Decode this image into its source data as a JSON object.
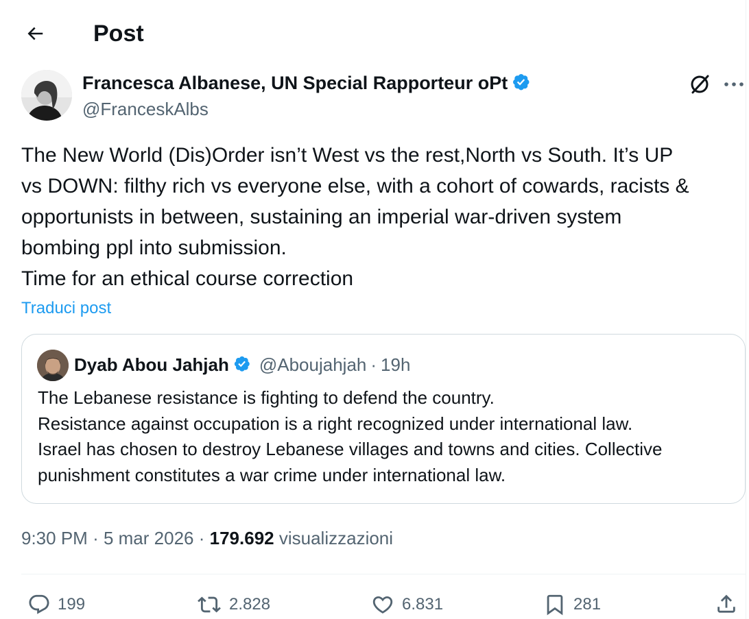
{
  "header": {
    "title": "Post",
    "back_icon": "arrow-left-icon"
  },
  "post": {
    "author": {
      "name": "Francesca Albanese, UN Special Rapporteur oPt",
      "handle": "@FranceskAlbs",
      "verified": true
    },
    "text_lines": [
      "The New World (Dis)Order isn’t West vs the rest,North vs South. It’s UP",
      "vs DOWN: filthy rich vs everyone else, with a cohort of cowards, racists &",
      "opportunists in between, sustaining an imperial war-driven system",
      "bombing ppl into submission.",
      "Time for an ethical course correction"
    ],
    "translate_label": "Traduci post",
    "time": "9:30 PM",
    "date": "5 mar 2026",
    "views_count": "179.692",
    "views_label": "visualizzazioni",
    "separator": "·"
  },
  "quote": {
    "author": {
      "name": "Dyab Abou Jahjah",
      "handle": "@Aboujahjah",
      "verified": true
    },
    "separator": "·",
    "time_ago": "19h",
    "text_lines": [
      "The Lebanese resistance is fighting to defend the country.",
      "Resistance against occupation is a right recognized under international law.",
      "Israel has chosen to destroy Lebanese villages and towns and cities. Collective",
      "punishment constitutes a war crime under international law."
    ]
  },
  "actions": {
    "replies": {
      "icon": "reply-icon",
      "count": "199"
    },
    "reposts": {
      "icon": "repost-icon",
      "count": "2.828"
    },
    "likes": {
      "icon": "heart-icon",
      "count": "6.831"
    },
    "bookmarks": {
      "icon": "bookmark-icon",
      "count": "281"
    },
    "share": {
      "icon": "share-icon"
    }
  },
  "colors": {
    "accent": "#1d9bf0",
    "text_primary": "#0f1419",
    "text_secondary": "#536471",
    "border": "#cfd9de"
  }
}
